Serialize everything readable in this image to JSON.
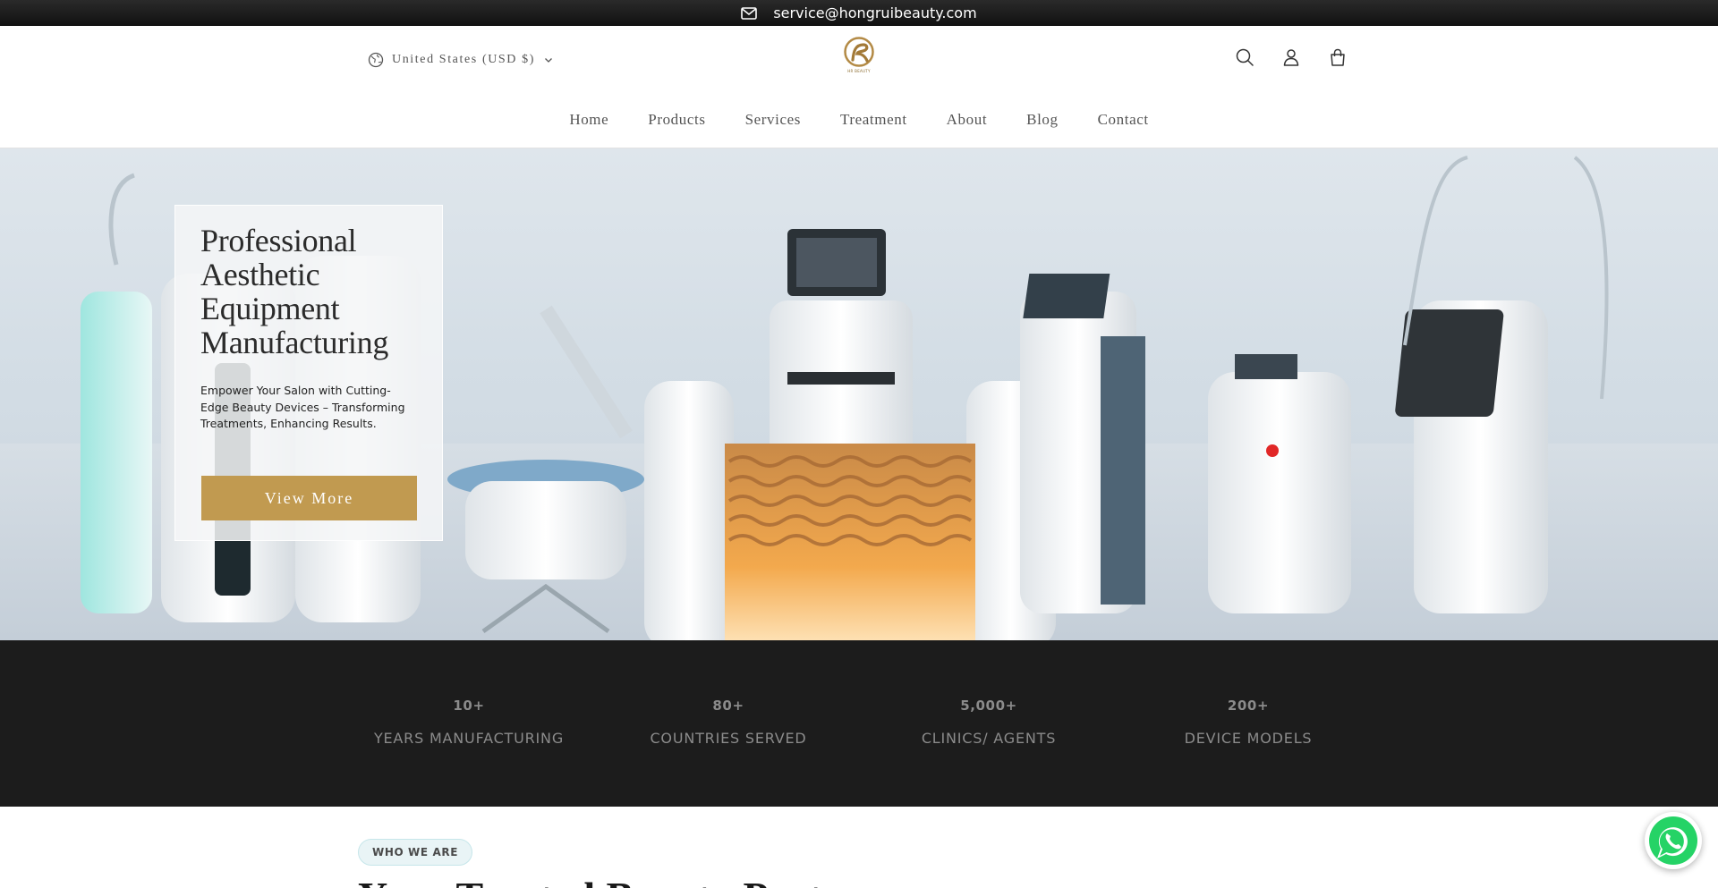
{
  "announcement": {
    "email": "service@hongruibeauty.com",
    "icon": "mail-icon"
  },
  "header": {
    "locale": "United States (USD $)",
    "logo_text": "HR BEAUTY",
    "icons": [
      "search-icon",
      "account-icon",
      "cart-icon"
    ],
    "nav": [
      "Home",
      "Products",
      "Services",
      "Treatment",
      "About",
      "Blog",
      "Contact"
    ]
  },
  "hero": {
    "title": "Professional Aesthetic Equipment Manufacturing",
    "subtitle": "Empower Your Salon with Cutting-Edge Beauty Devices – Transforming Treatments, Enhancing Results.",
    "button": "View More"
  },
  "stats": [
    {
      "value": "10+",
      "label": "YEARS MANUFACTURING"
    },
    {
      "value": "80+",
      "label": "COUNTRIES SERVED"
    },
    {
      "value": "5,000+",
      "label": "CLINICS/ AGENTS"
    },
    {
      "value": "200+",
      "label": "DEVICE MODELS"
    }
  ],
  "section": {
    "tag": "WHO WE ARE",
    "heading": "Your Trusted Beauty Partner"
  },
  "colors": {
    "accent_gold": "#c19a50",
    "dark": "#1c1c1c",
    "whatsapp": "#25d366"
  }
}
